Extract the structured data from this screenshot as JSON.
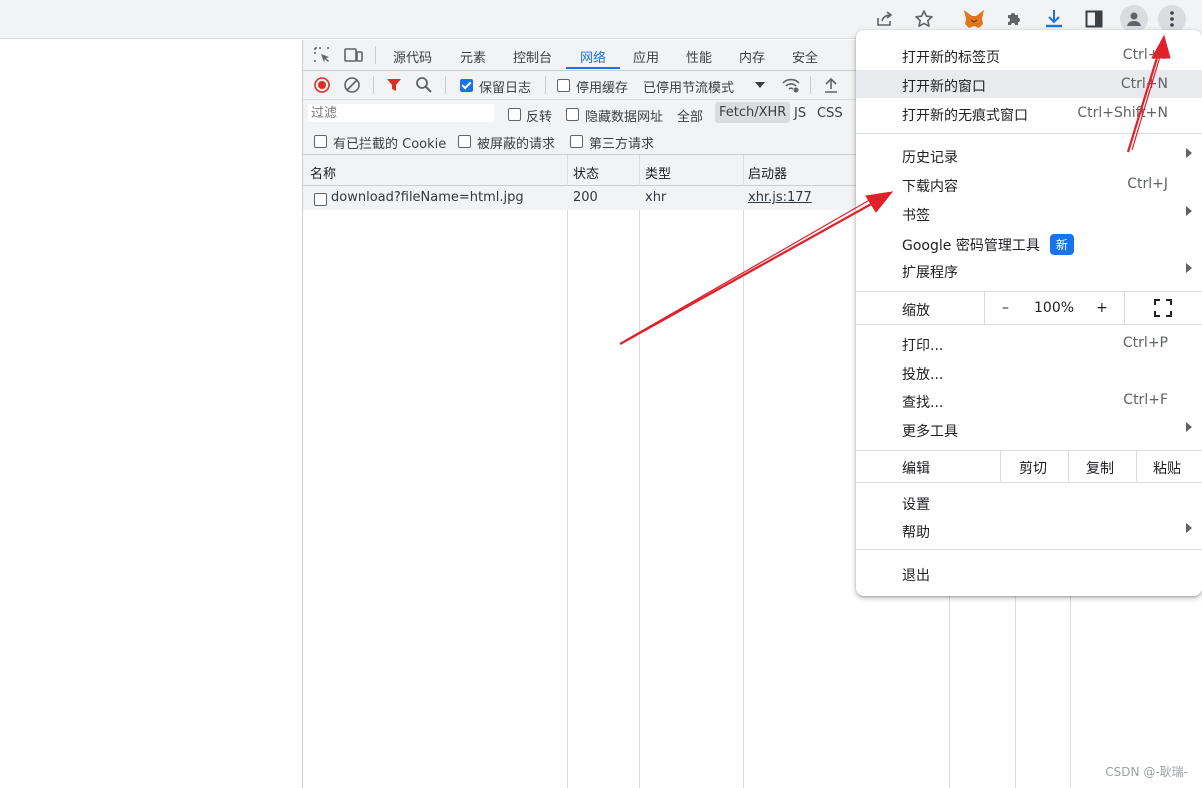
{
  "toolbar": {
    "icons": [
      "share-icon",
      "star-icon",
      "fox-extension-icon",
      "puzzle-icon",
      "download-icon",
      "side-panel-icon",
      "profile-icon",
      "more-vert-icon"
    ]
  },
  "devtools": {
    "tabs": [
      "源代码",
      "元素",
      "控制台",
      "网络",
      "应用",
      "性能",
      "内存",
      "安全"
    ],
    "active_tab": "网络",
    "toolbar": {
      "preserve_log": "保留日志",
      "disable_cache": "停用缓存",
      "throttling": "已停用节流模式"
    },
    "filter": {
      "placeholder": "过滤",
      "invert": "反转",
      "hide_data_urls": "隐藏数据网址",
      "types": [
        "全部",
        "Fetch/XHR",
        "JS",
        "CSS"
      ]
    },
    "filter2": {
      "blocked_cookies": "有已拦截的 Cookie",
      "blocked_requests": "被屏蔽的请求",
      "third_party": "第三方请求"
    },
    "columns": [
      "名称",
      "状态",
      "类型",
      "启动器"
    ],
    "rows": [
      {
        "name": "download?fileName=html.jpg",
        "status": "200",
        "type": "xhr",
        "initiator": "xhr.js:177"
      }
    ]
  },
  "menu": {
    "new_tab": "打开新的标签页",
    "new_tab_shortcut": "Ctrl+T",
    "new_window": "打开新的窗口",
    "new_window_shortcut": "Ctrl+N",
    "incognito": "打开新的无痕式窗口",
    "incognito_shortcut": "Ctrl+Shift+N",
    "history": "历史记录",
    "downloads": "下载内容",
    "downloads_shortcut": "Ctrl+J",
    "bookmarks": "书签",
    "passwords": "Google 密码管理工具",
    "new_badge": "新",
    "extensions": "扩展程序",
    "zoom_label": "缩放",
    "zoom_minus": "–",
    "zoom_value": "100%",
    "zoom_plus": "+",
    "print": "打印...",
    "print_shortcut": "Ctrl+P",
    "cast": "投放...",
    "find": "查找...",
    "find_shortcut": "Ctrl+F",
    "more_tools": "更多工具",
    "edit_label": "编辑",
    "cut": "剪切",
    "copy": "复制",
    "paste": "粘贴",
    "settings": "设置",
    "help": "帮助",
    "exit": "退出"
  },
  "watermark": "CSDN @-耿瑞-",
  "colors": {
    "accent": "#1a73e8",
    "annotation": "#e0202a"
  }
}
